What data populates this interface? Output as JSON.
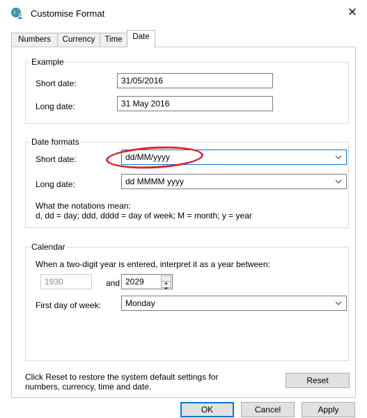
{
  "window": {
    "title": "Customise Format",
    "close_symbol": "✕"
  },
  "tabs": [
    {
      "label": "Numbers"
    },
    {
      "label": "Currency"
    },
    {
      "label": "Time"
    },
    {
      "label": "Date",
      "active": true
    }
  ],
  "example": {
    "group_title": "Example",
    "short_label": "Short date:",
    "short_value": "31/05/2016",
    "long_label": "Long date:",
    "long_value": "31 May 2016"
  },
  "formats": {
    "group_title": "Date formats",
    "short_label": "Short date:",
    "short_value": "dd/MM/yyyy",
    "long_label": "Long date:",
    "long_value": "dd MMMM yyyy",
    "notation_heading": "What the notations mean:",
    "notation_text": "d, dd = day;  ddd, dddd = day of week;  M = month;  y = year"
  },
  "calendar": {
    "group_title": "Calendar",
    "two_digit_text": "When a two-digit year is entered, interpret it as a year between:",
    "from_year": "1930",
    "and_label": "and",
    "to_year": "2029",
    "first_day_label": "First day of week:",
    "first_day_value": "Monday"
  },
  "reset": {
    "text_line1": "Click Reset to restore the system default settings for",
    "text_line2": "numbers, currency, time and date.",
    "button": "Reset"
  },
  "buttons": {
    "ok": "OK",
    "cancel": "Cancel",
    "apply": "Apply"
  },
  "colors": {
    "accent": "#0078d7",
    "highlight": "#d8262e"
  },
  "icons": {
    "title": "globe-person-icon",
    "close": "close-icon",
    "dropdown": "chevron-down-icon"
  }
}
